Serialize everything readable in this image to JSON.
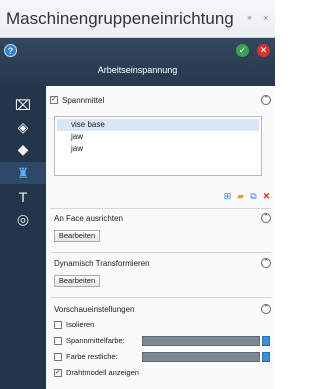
{
  "window": {
    "title": "Maschinengruppeneinrichtung",
    "pin_glyph": "⌖",
    "close_glyph": "×"
  },
  "header": {
    "subtitle": "Arbeitseinspannung",
    "help_glyph": "?",
    "ok_glyph": "✓",
    "cancel_glyph": "✕"
  },
  "sidebar": {
    "items": [
      {
        "icon": "machine-icon",
        "glyph": "⌧"
      },
      {
        "icon": "stock-icon",
        "glyph": "◈"
      },
      {
        "icon": "cube-icon",
        "glyph": "◆"
      },
      {
        "icon": "fixture-icon",
        "glyph": "♜"
      },
      {
        "icon": "tool-icon",
        "glyph": "T"
      },
      {
        "icon": "layers-icon",
        "glyph": "◎"
      }
    ],
    "active_index": 3
  },
  "spannmittel": {
    "label": "Spannmittel",
    "checked": true,
    "collapse_glyph": "⌃",
    "items": [
      "vise base",
      "jaw",
      "jaw"
    ],
    "selected_index": 0
  },
  "face": {
    "label": "An Face ausrichten",
    "button": "Bearbeiten",
    "collapse_glyph": "⌃"
  },
  "dynamic": {
    "label": "Dynamisch Transformieren",
    "button": "Bearbeiten",
    "collapse_glyph": "⌃"
  },
  "preview": {
    "label": "Vorschaueinstellungen",
    "collapse_glyph": "⌃",
    "options": [
      {
        "label": "Isolieren",
        "checked": false
      },
      {
        "label": "Spannmittelfarbe:",
        "checked": false
      },
      {
        "label": "Farbe restliche:",
        "checked": false
      },
      {
        "label": "Drahtmodell anzeigen",
        "checked": true
      }
    ]
  },
  "colors": {
    "accent_blue": "#2d7fd3",
    "header_bg": "#2b3f55",
    "ok_green": "#35a44b",
    "cancel_red": "#d9342b"
  }
}
